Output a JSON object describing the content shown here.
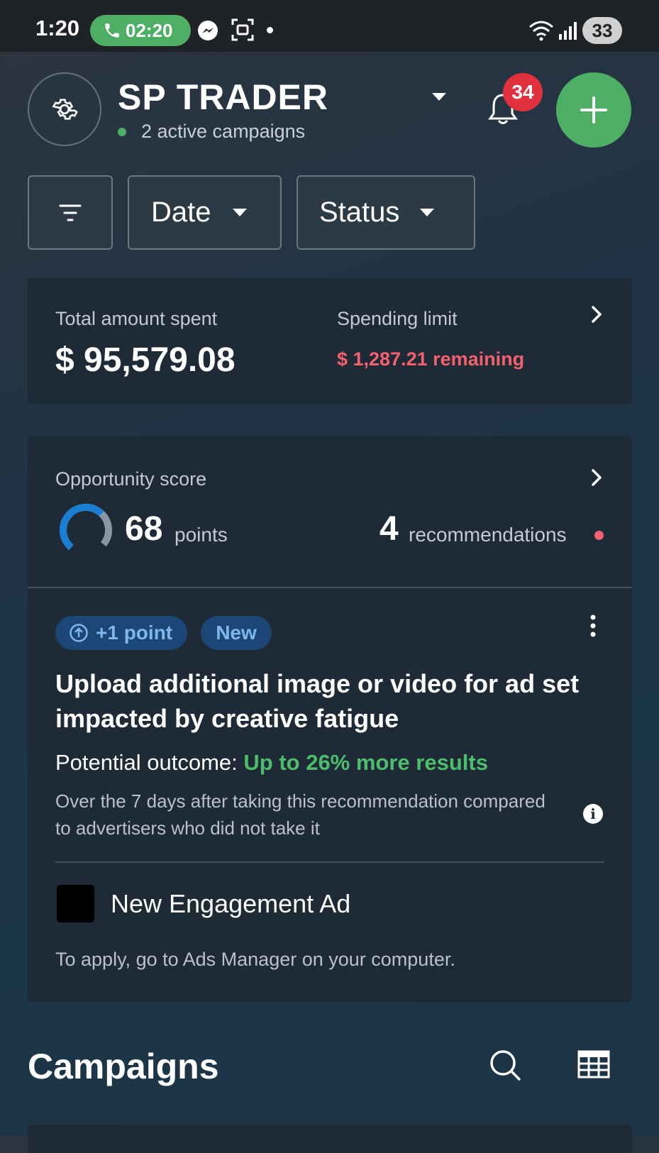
{
  "status_bar": {
    "time": "1:20",
    "call_timer": "02:20",
    "battery": "33",
    "icons": [
      "phone-icon",
      "messenger-icon",
      "screenshot-icon",
      "wifi-icon",
      "signal-icon"
    ]
  },
  "header": {
    "account_name": "SP TRADER",
    "active_campaigns": "2 active campaigns",
    "notifications_count": "34",
    "colors": {
      "fab": "#4caf63",
      "badge": "#e0323e"
    }
  },
  "filters": {
    "date_label": "Date",
    "status_label": "Status"
  },
  "spend_card": {
    "total_label": "Total amount spent",
    "total_value": "$ 95,579.08",
    "limit_label": "Spending limit",
    "limit_remaining": "$ 1,287.21 remaining",
    "colors": {
      "remaining": "#f2616d"
    }
  },
  "opportunity": {
    "label": "Opportunity score",
    "points": "68",
    "points_label": "points",
    "score_fraction": 0.68,
    "recommendations": "4",
    "recommendations_label": "recommendations"
  },
  "recommendation": {
    "point_badge": "+1 point",
    "new_badge": "New",
    "title": "Upload additional image or video for ad set impacted by creative fatigue",
    "outcome_prefix": "Potential outcome:",
    "outcome_highlight": "Up to 26% more results",
    "detail": "Over the 7 days after taking this recommendation compared to advertisers who did not take it",
    "ad_name": "New Engagement Ad",
    "apply_note": "To apply, go to Ads Manager on your computer.",
    "colors": {
      "highlight": "#4dbd6b"
    }
  },
  "campaigns": {
    "title": "Campaigns"
  }
}
